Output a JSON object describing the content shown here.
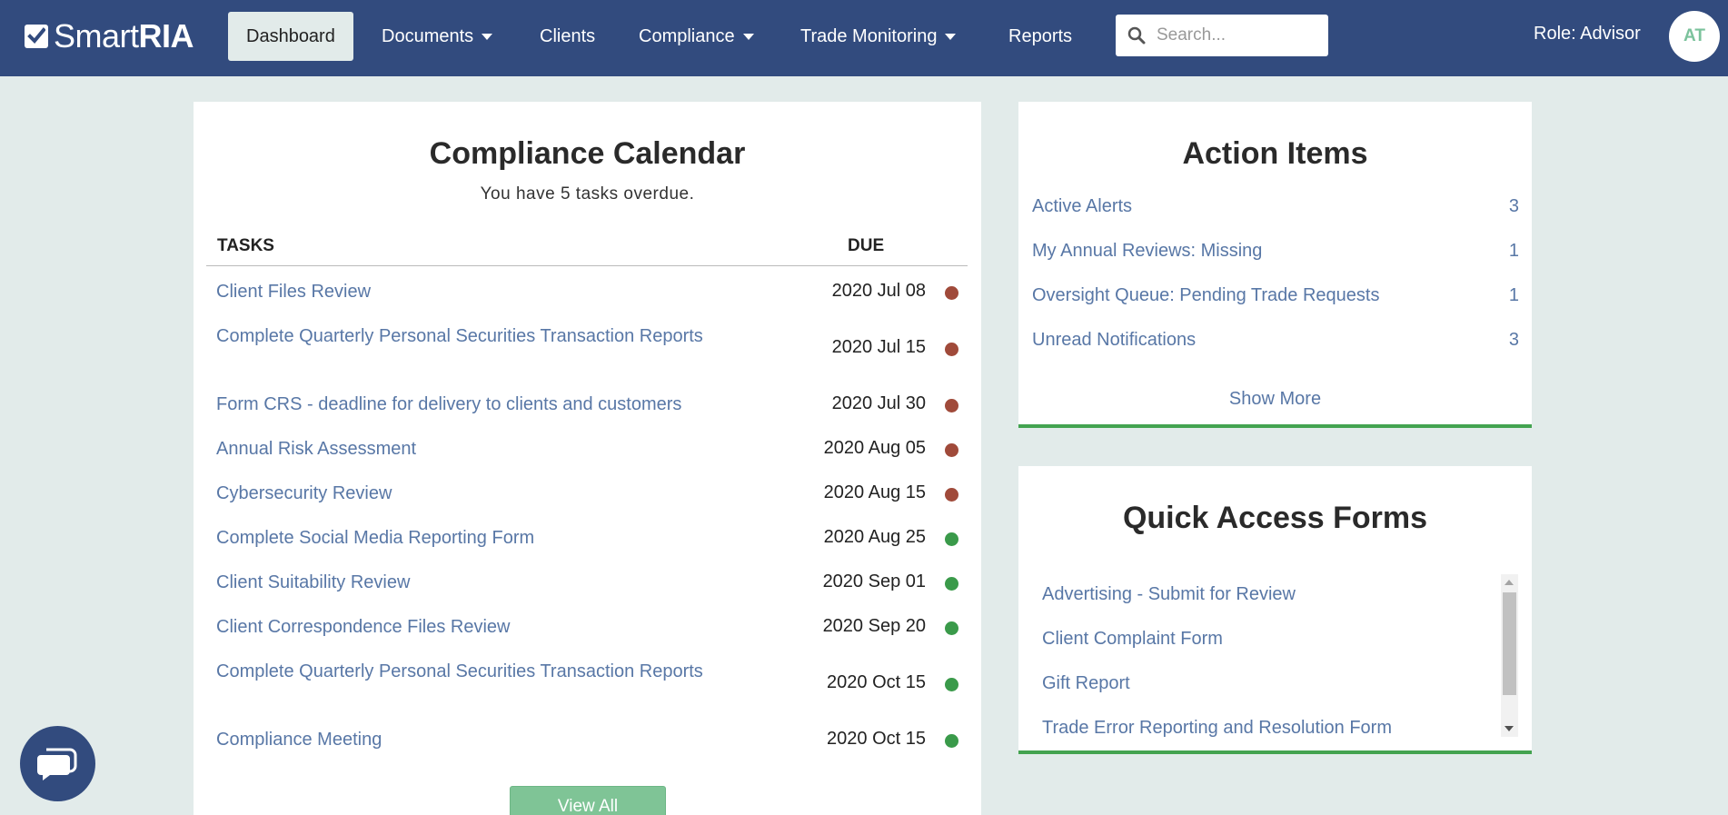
{
  "brand": {
    "name_light": "Smart",
    "name_bold": "RIA"
  },
  "nav": {
    "dashboard": "Dashboard",
    "documents": "Documents",
    "clients": "Clients",
    "compliance": "Compliance",
    "trade_monitoring": "Trade Monitoring",
    "reports": "Reports"
  },
  "search": {
    "placeholder": "Search...",
    "value": ""
  },
  "user": {
    "role": "Role: Advisor",
    "initials": "AT"
  },
  "calendar": {
    "title": "Compliance Calendar",
    "subtitle": "You have 5 tasks overdue.",
    "col_tasks": "TASKS",
    "col_due": "DUE",
    "tasks": [
      {
        "name": "Client Files Review",
        "due": "2020 Jul 08",
        "status": "overdue"
      },
      {
        "name": "Complete Quarterly Personal Securities Transaction Reports",
        "due": "2020 Jul 15",
        "status": "overdue"
      },
      {
        "name": "Form CRS - deadline for delivery to clients and customers",
        "due": "2020 Jul 30",
        "status": "overdue"
      },
      {
        "name": "Annual Risk Assessment",
        "due": "2020 Aug 05",
        "status": "overdue"
      },
      {
        "name": "Cybersecurity Review",
        "due": "2020 Aug 15",
        "status": "overdue"
      },
      {
        "name": "Complete Social Media Reporting Form",
        "due": "2020 Aug 25",
        "status": "upcoming"
      },
      {
        "name": "Client Suitability Review",
        "due": "2020 Sep 01",
        "status": "upcoming"
      },
      {
        "name": "Client Correspondence Files Review",
        "due": "2020 Sep 20",
        "status": "upcoming"
      },
      {
        "name": "Complete Quarterly Personal Securities Transaction Reports",
        "due": "2020 Oct 15",
        "status": "upcoming"
      },
      {
        "name": "Compliance Meeting",
        "due": "2020 Oct 15",
        "status": "upcoming"
      }
    ],
    "view_all": "View All"
  },
  "action_items": {
    "title": "Action Items",
    "items": [
      {
        "label": "Active Alerts",
        "count": "3"
      },
      {
        "label": "My Annual Reviews: Missing",
        "count": "1"
      },
      {
        "label": "Oversight Queue: Pending Trade Requests",
        "count": "1"
      },
      {
        "label": "Unread Notifications",
        "count": "3"
      }
    ],
    "show_more": "Show More"
  },
  "quick_forms": {
    "title": "Quick Access Forms",
    "items": [
      "Advertising - Submit for Review",
      "Client Complaint Form",
      "Gift Report",
      "Trade Error Reporting and Resolution Form"
    ]
  },
  "colors": {
    "navbar": "#324b7e",
    "link": "#5877a6",
    "overdue": "#a04a3a",
    "upcoming": "#3a9a4a",
    "accent_green": "#43a350",
    "button_green": "#7fc496",
    "background": "#e2ebea"
  },
  "icons": {
    "logo": "checkbox-icon",
    "search": "magnifier-icon",
    "chat": "chat-bubble-icon",
    "caret": "caret-down-icon"
  }
}
